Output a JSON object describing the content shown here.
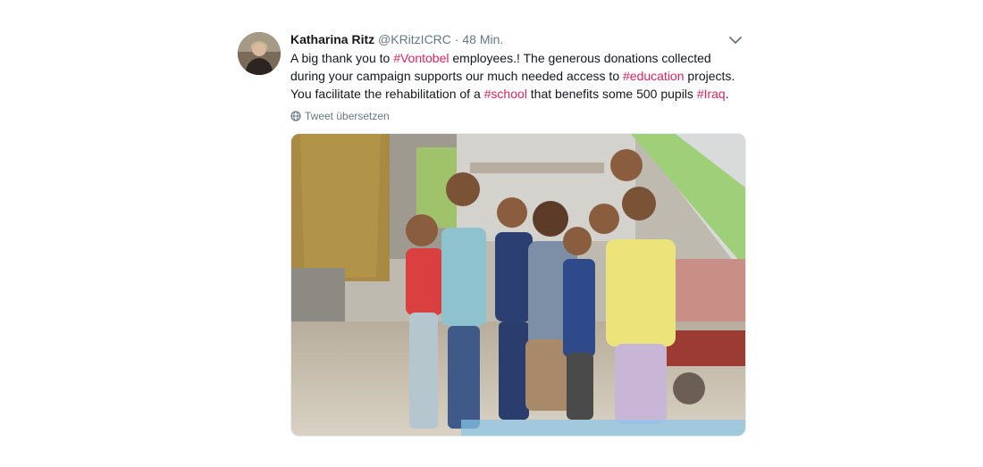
{
  "tweet": {
    "author_name": "Katharina Ritz",
    "handle": "@KRitzICRC",
    "separator": "·",
    "time": "48 Min.",
    "text_segments": {
      "s1": "A big thank you to ",
      "h1": "#Vontobel",
      "s2": " employees.! The generous donations collected during your campaign supports our much needed access to ",
      "h2": "#education",
      "s3": " projects. You facilitate the rehabilitation of a ",
      "h3": "#school",
      "s4": " that benefits some 500 pupils ",
      "h4": "#Iraq",
      "s5": "."
    },
    "translate_label": "Tweet übersetzen",
    "icons": {
      "menu": "chevron-down-icon",
      "translate": "globe-icon"
    }
  },
  "colors": {
    "hashtag": "#e0245e",
    "secondary_text": "#657786",
    "primary_text": "#14171a"
  }
}
